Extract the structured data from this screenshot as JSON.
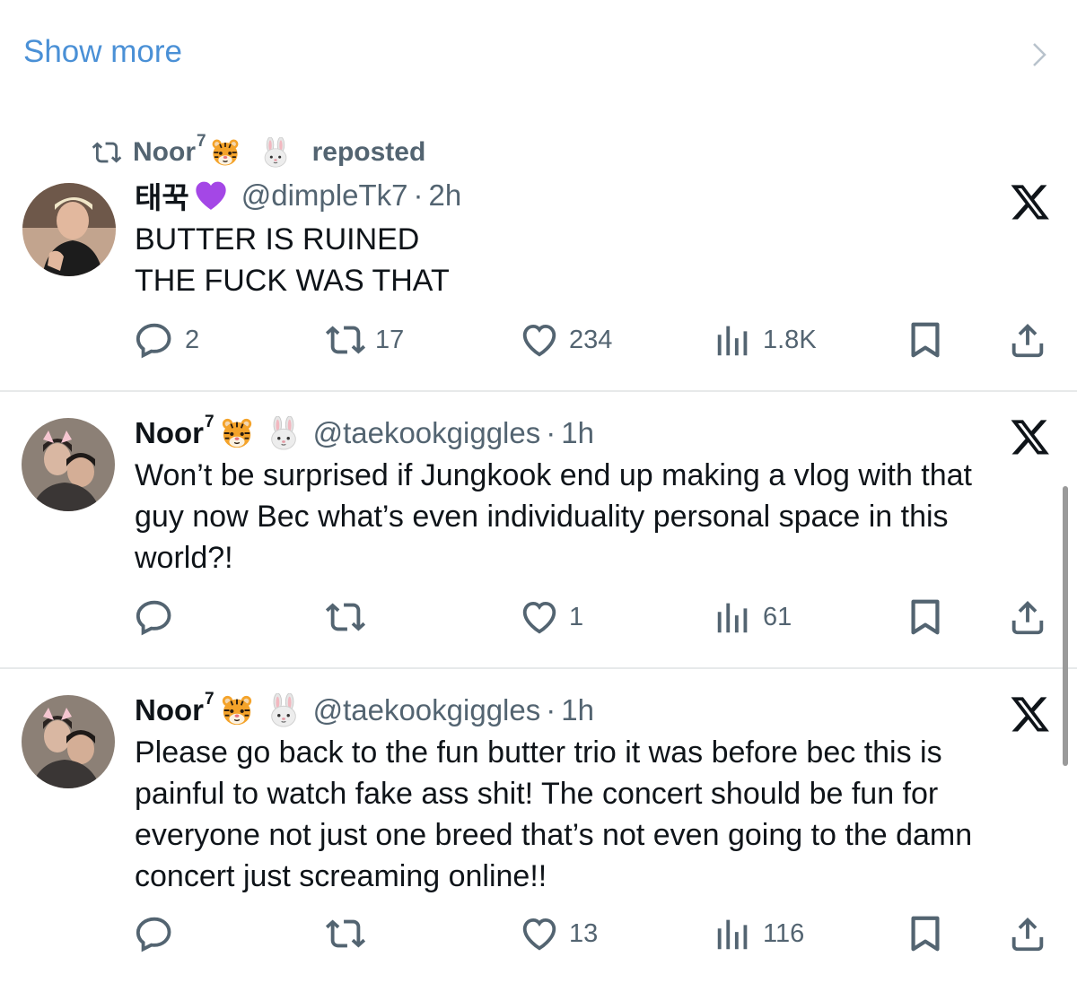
{
  "top": {
    "show_more": "Show more"
  },
  "repost": {
    "user": "Noor",
    "sup": "7",
    "text": "reposted"
  },
  "tweets": [
    {
      "name": "태꾹",
      "handle": "@dimpleTk7",
      "dot": "·",
      "time": "2h",
      "lines": [
        "BUTTER IS RUINED",
        "THE FUCK WAS THAT"
      ],
      "replies": "2",
      "reposts": "17",
      "likes": "234",
      "views": "1.8K"
    },
    {
      "name": "Noor",
      "sup": "7",
      "handle": "@taekookgiggles",
      "dot": "·",
      "time": "1h",
      "lines": [
        "Won’t be surprised if Jungkook end up making a vlog with that",
        "guy now Bec what’s even individuality personal space in this",
        "world?!"
      ],
      "replies": "",
      "reposts": "",
      "likes": "1",
      "views": "61"
    },
    {
      "name": "Noor",
      "sup": "7",
      "handle": "@taekookgiggles",
      "dot": "·",
      "time": "1h",
      "lines": [
        "Please go back to the fun butter trio it was before bec this is",
        "painful to watch fake ass shit! The concert should be fun for",
        "everyone not just one breed that’s not even going to the damn",
        "concert just screaming online!!"
      ],
      "replies": "",
      "reposts": "",
      "likes": "13",
      "views": "116"
    }
  ],
  "icons": {
    "reply": "reply-icon",
    "repost": "repost-icon",
    "like": "heart-icon",
    "views": "views-icon",
    "bookmark": "bookmark-icon",
    "share": "share-icon",
    "x": "x-logo-icon",
    "tiger": "tiger-emoji-icon",
    "rabbit": "rabbit-emoji-icon",
    "purple_heart": "purple-heart-emoji-icon"
  },
  "colors": {
    "link": "#4a90d6",
    "secondary": "#536471",
    "text": "#0f1419"
  }
}
